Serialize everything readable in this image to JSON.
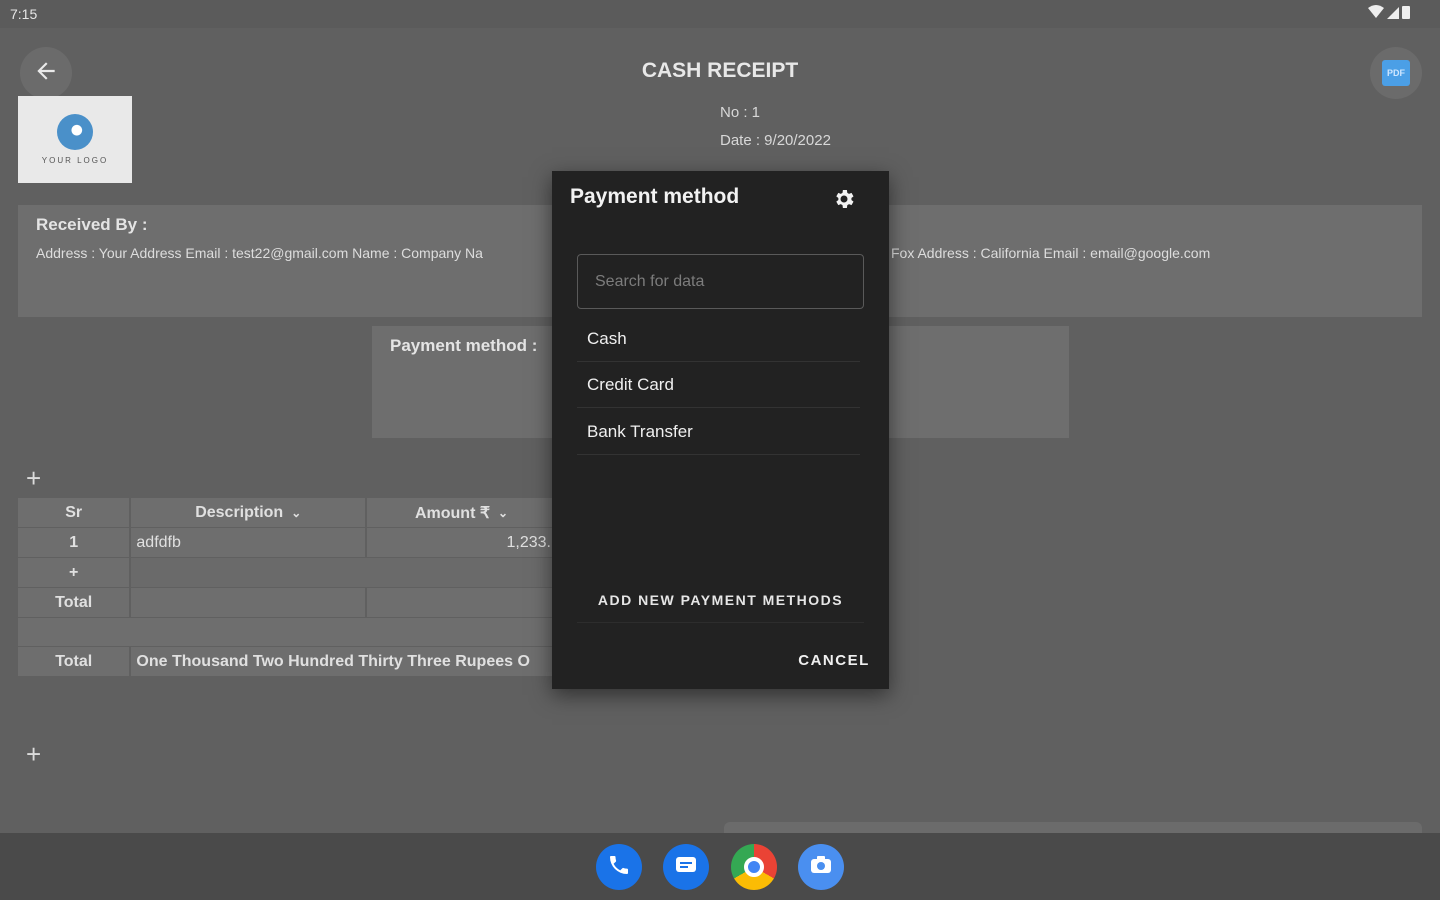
{
  "status": {
    "time": "7:15"
  },
  "header": {
    "title": "CASH RECEIPT",
    "pdf_label": "PDF"
  },
  "logo": {
    "text": "YOUR LOGO"
  },
  "receipt": {
    "no": "No : 1",
    "date": "Date : 9/20/2022"
  },
  "received": {
    "label": "Received By :",
    "address": "Address : Your Address Email : test22@gmail.com Name : Company Na",
    "address_right": "Fox Address : California Email : email@google.com"
  },
  "payment_box": {
    "label": "Payment method :"
  },
  "table": {
    "headers": [
      "Sr",
      "Description",
      "Amount ₹"
    ],
    "rows": [
      {
        "sr": "1",
        "description": "adfdfb",
        "amount": "1,233."
      }
    ],
    "add_row": "+",
    "total_label": "Total",
    "total_words_label": "Total",
    "total_words": "One Thousand Two Hundred Thirty Three Rupees O"
  },
  "dialog": {
    "title": "Payment method",
    "search_placeholder": "Search for data",
    "options": [
      "Cash",
      "Credit Card",
      "Bank Transfer"
    ],
    "add_label": "ADD NEW PAYMENT METHODS",
    "cancel_label": "CANCEL"
  },
  "dock": [
    "phone-icon",
    "messages-icon",
    "chrome-icon",
    "camera-icon"
  ]
}
